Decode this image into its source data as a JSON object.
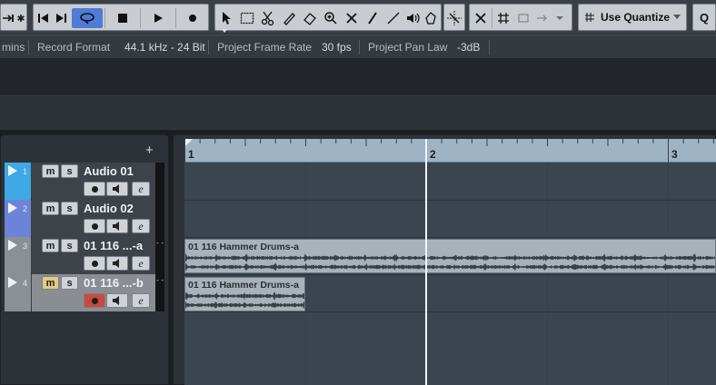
{
  "toolbar": {
    "use_quantize_label": "Use Quantize",
    "quantize_key": "Q",
    "icons": [
      "arrows-icon",
      "star-icon",
      "goto-start-icon",
      "goto-end-icon",
      "cycle-icon",
      "stop-icon",
      "play-icon",
      "record-icon",
      "pointer-icon",
      "range-icon",
      "split-icon",
      "glue-icon",
      "erase-icon",
      "zoom-icon",
      "mute-icon",
      "draw-icon",
      "line-icon",
      "speaker-icon",
      "warp-icon",
      "snap-icon",
      "grid-icon"
    ]
  },
  "infoline": {
    "mins": "mins",
    "record_format_label": "Record Format",
    "record_format_value": "44.1 kHz - 24 Bit",
    "frame_rate_label": "Project Frame Rate",
    "frame_rate_value": "30 fps",
    "pan_law_label": "Project Pan Law",
    "pan_law_value": "-3dB"
  },
  "tracklist": {
    "add_track": "+",
    "tracks": [
      {
        "number": "1",
        "name": "Audio 01",
        "color": "#3fa8e6",
        "mute": "m",
        "solo": "s",
        "edit": "e",
        "muted": false,
        "armed": false,
        "selected": false,
        "strip_mark": ""
      },
      {
        "number": "2",
        "name": "Audio 02",
        "color": "#6b84d8",
        "mute": "m",
        "solo": "s",
        "edit": "e",
        "muted": false,
        "armed": false,
        "selected": false,
        "strip_mark": ""
      },
      {
        "number": "3",
        "name": "01 116 ...-a",
        "color": "#8a9096",
        "mute": "m",
        "solo": "s",
        "edit": "e",
        "muted": false,
        "armed": false,
        "selected": false,
        "strip_mark": "- -"
      },
      {
        "number": "4",
        "name": "01 116 ...-b",
        "color": "#8a9096",
        "mute": "m",
        "solo": "s",
        "edit": "e",
        "muted": true,
        "armed": true,
        "selected": true,
        "strip_mark": "- -"
      }
    ]
  },
  "ruler": {
    "bars": [
      "1",
      "2",
      "3"
    ]
  },
  "events": [
    {
      "track": 3,
      "name": "01 116 Hammer Drums-a"
    },
    {
      "track": 4,
      "name": "01 116 Hammer Drums-a"
    }
  ],
  "colors": {
    "accent": "#4f7bd6",
    "cursor": "#f2f4f6",
    "ruler": "#9eb3c4",
    "event": "#a8b2bb",
    "lane": "#3a4550"
  }
}
